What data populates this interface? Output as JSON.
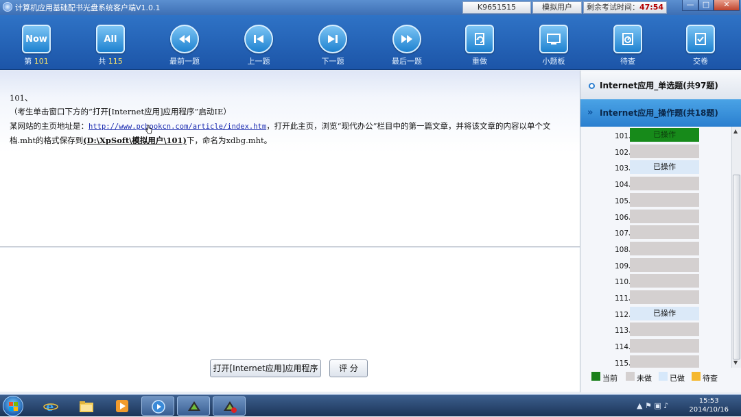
{
  "window": {
    "title": "计算机应用基础配书光盘系统客户端V1.0.1",
    "exam_id": "K9651515",
    "user": "模拟用户",
    "remaining_label": "剩余考试时间：",
    "remaining_time": "47:54",
    "minimize": "—",
    "maximize": "□",
    "close": "✕"
  },
  "toolbar": {
    "items": [
      {
        "icon": "now-icon",
        "icon_text": "Now",
        "label": "第",
        "value": "101"
      },
      {
        "icon": "all-icon",
        "icon_text": "All",
        "label": "共",
        "value": "115"
      },
      {
        "icon": "first-question-icon",
        "label": "最前一题"
      },
      {
        "icon": "previous-question-icon",
        "label": "上一题"
      },
      {
        "icon": "next-question-icon",
        "label": "下一题"
      },
      {
        "icon": "last-question-icon",
        "label": "最后一题"
      },
      {
        "icon": "redo-icon",
        "label": "重做"
      },
      {
        "icon": "question-board-icon",
        "label": "小题板"
      },
      {
        "icon": "review-later-icon",
        "label": "待查"
      },
      {
        "icon": "submit-icon",
        "label": "交卷"
      }
    ]
  },
  "question": {
    "number": "101、",
    "hint": "（考生单击窗口下方的“打开[Internet应用]应用程序”启动IE）",
    "text_prefix": "某网站的主页地址是：",
    "url": "http://www.pcbookcn.com/article/index.htm",
    "text_middle": "，打开此主页，浏览“现代办公”栏目中的第一篇文章，并将该文章的内容以单个文",
    "text_line2_prefix": "档.mht的格式保存到",
    "save_path": "(D:\\XpSoft\\模拟用户\\101)",
    "text_line2_suffix": "下，命名为xdbg.mht。"
  },
  "buttons": {
    "open_app": "打开[Internet应用]应用程序",
    "grade": "评 分"
  },
  "sidebar": {
    "section1": "Internet应用_单选题(共97题)",
    "section2": "Internet应用_操作题(共18题)",
    "rows": [
      {
        "num": "101、",
        "status": "已操作",
        "state": "current"
      },
      {
        "num": "102、",
        "status": "",
        "state": "todo"
      },
      {
        "num": "103、",
        "status": "已操作",
        "state": "done"
      },
      {
        "num": "104、",
        "status": "",
        "state": "todo"
      },
      {
        "num": "105、",
        "status": "",
        "state": "todo"
      },
      {
        "num": "106、",
        "status": "",
        "state": "todo"
      },
      {
        "num": "107、",
        "status": "",
        "state": "todo"
      },
      {
        "num": "108、",
        "status": "",
        "state": "todo"
      },
      {
        "num": "109、",
        "status": "",
        "state": "todo"
      },
      {
        "num": "110、",
        "status": "",
        "state": "todo"
      },
      {
        "num": "111、",
        "status": "",
        "state": "todo"
      },
      {
        "num": "112、",
        "status": "已操作",
        "state": "done"
      },
      {
        "num": "113、",
        "status": "",
        "state": "todo"
      },
      {
        "num": "114、",
        "status": "",
        "state": "todo"
      },
      {
        "num": "115、",
        "status": "",
        "state": "todo"
      }
    ],
    "legend": [
      {
        "label": "当前",
        "color": "#1a7f1a"
      },
      {
        "label": "未做",
        "color": "#d4d0d0"
      },
      {
        "label": "已做",
        "color": "#d6e8fa"
      },
      {
        "label": "待查",
        "color": "#f5b82e"
      }
    ]
  },
  "taskbar": {
    "time": "15:53",
    "date": "2014/10/16",
    "apps": [
      "start-button",
      "ie-icon",
      "explorer-icon",
      "media-player-icon",
      "media-center-icon",
      "exam-app-icon",
      "exam-client-icon"
    ]
  },
  "colors": {
    "toolbar_bg": "#2467bb",
    "accent": "#2a7fcf",
    "current": "#1a7f1a",
    "time": "#b40000"
  }
}
